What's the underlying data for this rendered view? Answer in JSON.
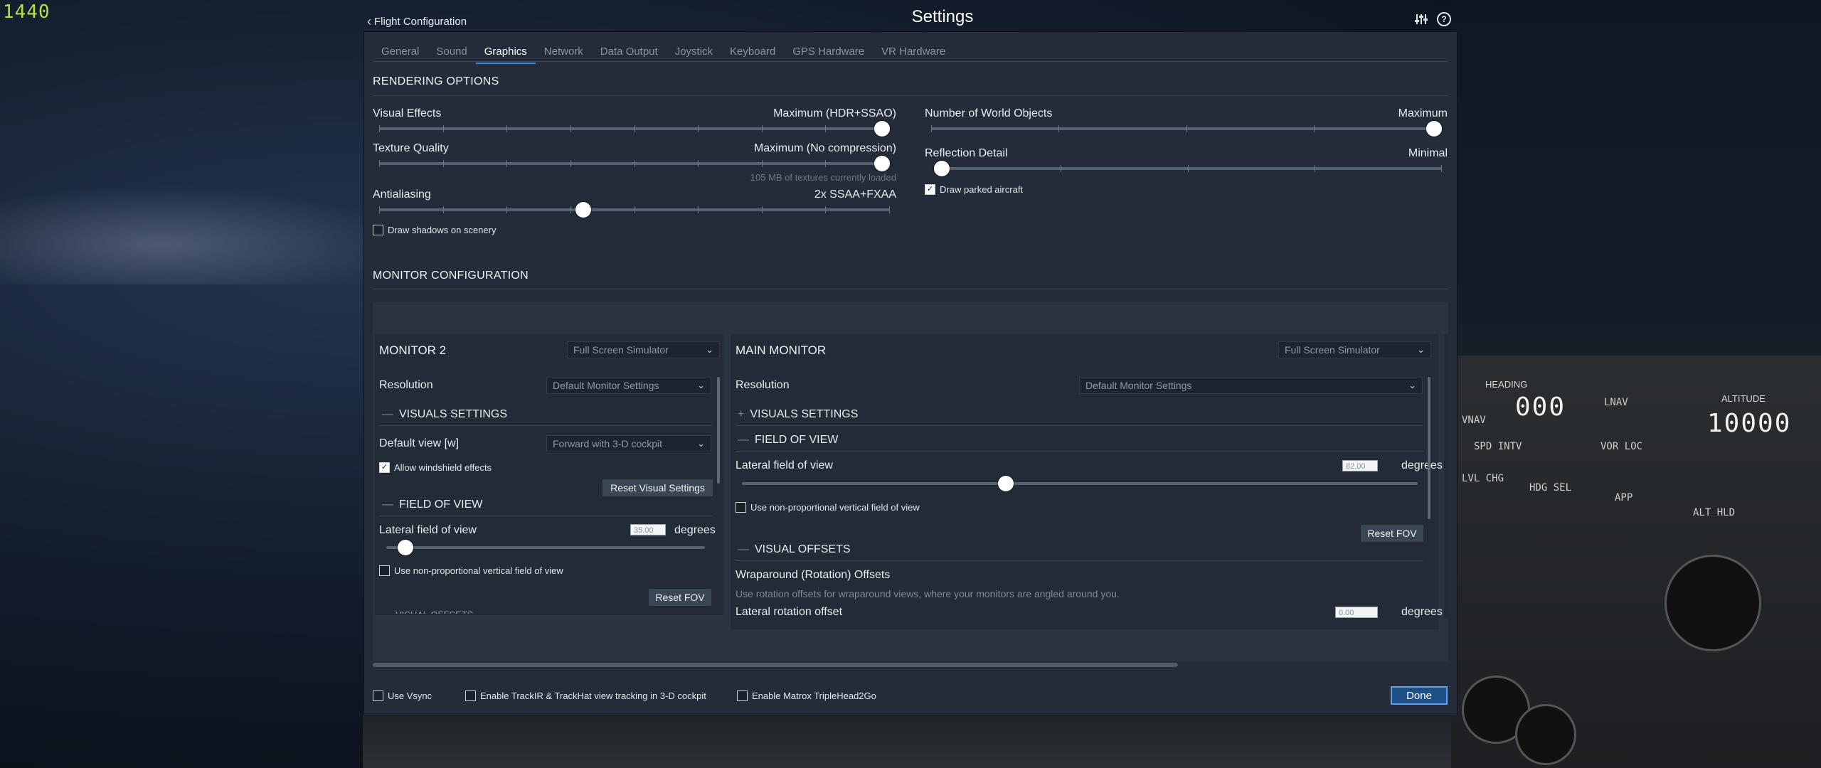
{
  "hud": {
    "fps": "1440",
    "heading_label": "HEADING",
    "heading_value": "000",
    "altitude_label": "ALTITUDE",
    "altitude_value": "10000",
    "lnav": "LNAV",
    "vnav": "VNAV",
    "vor_loc": "VOR LOC",
    "lvl_chg": "LVL CHG",
    "hdg_sel": "HDG SEL",
    "app": "APP",
    "alt_hld": "ALT HLD",
    "spd_intv": "SPD INTV"
  },
  "header": {
    "back_label": "Flight Configuration",
    "title": "Settings"
  },
  "tabs": [
    {
      "label": "General"
    },
    {
      "label": "Sound"
    },
    {
      "label": "Graphics"
    },
    {
      "label": "Network"
    },
    {
      "label": "Data Output"
    },
    {
      "label": "Joystick"
    },
    {
      "label": "Keyboard"
    },
    {
      "label": "GPS Hardware"
    },
    {
      "label": "VR Hardware"
    }
  ],
  "active_tab": "Graphics",
  "rendering": {
    "heading": "RENDERING OPTIONS",
    "visual_effects": {
      "label": "Visual Effects",
      "value": "Maximum (HDR+SSAO)",
      "level": 1.0
    },
    "texture_quality": {
      "label": "Texture Quality",
      "value": "Maximum (No compression)",
      "level": 1.0,
      "hint": "105 MB of textures currently loaded"
    },
    "antialiasing": {
      "label": "Antialiasing",
      "value": "2x SSAA+FXAA",
      "level": 0.4
    },
    "draw_shadows": {
      "label": "Draw shadows on scenery",
      "checked": false
    },
    "world_objects": {
      "label": "Number of World Objects",
      "value": "Maximum",
      "level": 1.0
    },
    "reflection": {
      "label": "Reflection Detail",
      "value": "Minimal",
      "level": 0.0
    },
    "draw_parked": {
      "label": "Draw parked aircraft",
      "checked": true
    }
  },
  "monitor_config": {
    "heading": "MONITOR CONFIGURATION",
    "monitor2": {
      "title": "MONITOR 2",
      "mode": "Full Screen Simulator",
      "resolution_label": "Resolution",
      "resolution_value": "Default Monitor Settings",
      "visuals_heading": "VISUALS SETTINGS",
      "default_view_label": "Default view [w]",
      "default_view_value": "Forward with 3-D cockpit",
      "allow_windshield": "Allow windshield effects",
      "allow_windshield_checked": true,
      "reset_visual": "Reset Visual Settings",
      "fov_heading": "FIELD OF VIEW",
      "lateral_fov_label": "Lateral field of view",
      "lateral_fov_value": "35.00",
      "degrees": "degrees",
      "fov_level": 0.06,
      "nonprop": "Use non-proportional vertical field of view",
      "reset_fov": "Reset FOV",
      "cut_heading": "VISUAL OFFSETS"
    },
    "main": {
      "title": "MAIN MONITOR",
      "mode": "Full Screen Simulator",
      "resolution_label": "Resolution",
      "resolution_value": "Default Monitor Settings",
      "visuals_heading": "VISUALS SETTINGS",
      "fov_heading": "FIELD OF VIEW",
      "lateral_fov_label": "Lateral field of view",
      "lateral_fov_value": "82.00",
      "degrees": "degrees",
      "fov_level": 0.39,
      "nonprop": "Use non-proportional vertical field of view",
      "reset_fov": "Reset FOV",
      "offsets_heading": "VISUAL OFFSETS",
      "wrap_heading": "Wraparound (Rotation) Offsets",
      "wrap_desc": "Use rotation offsets for wraparound views, where your monitors are angled around you.",
      "lateral_rotation_label": "Lateral rotation offset",
      "lateral_rotation_value": "0.00"
    }
  },
  "footer": {
    "vsync": "Use Vsync",
    "trackir": "Enable TrackIR & TrackHat view tracking in 3-D cockpit",
    "matrox": "Enable Matrox TripleHead2Go",
    "done": "Done"
  }
}
